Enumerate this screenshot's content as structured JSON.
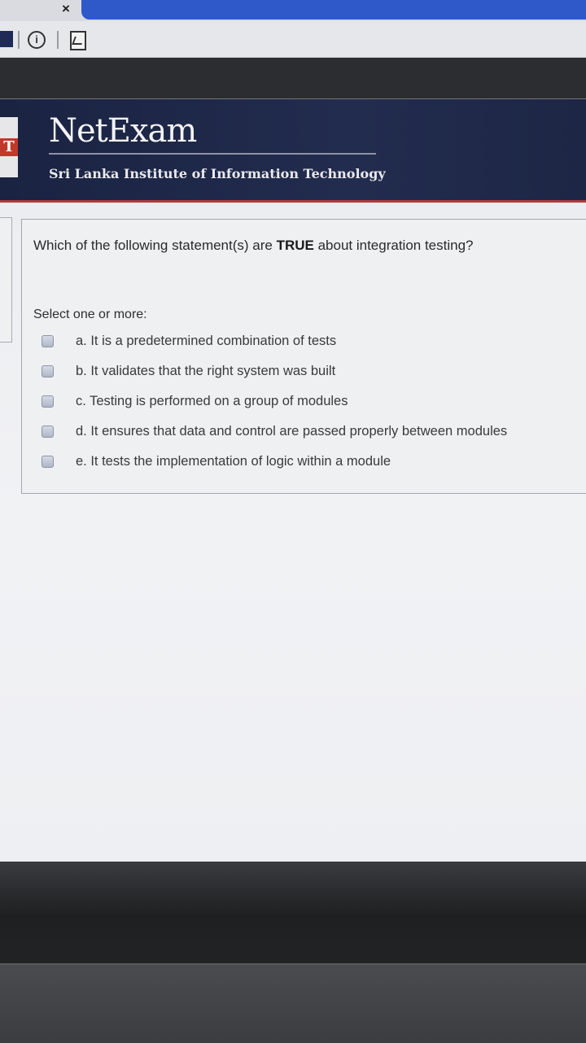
{
  "browser": {
    "tab_close_glyph": "×"
  },
  "header": {
    "title": "NetExam",
    "subtitle": "Sri Lanka Institute of Information Technology"
  },
  "question": {
    "prefix": "Which of the following statement(s) are ",
    "emphasis": "TRUE",
    "suffix": " about integration testing?",
    "prompt": "Select one or more:",
    "options": [
      {
        "label": "a. It is a predetermined combination of tests",
        "checked": false
      },
      {
        "label": "b. It validates that the right system was built",
        "checked": false
      },
      {
        "label": "c. Testing is performed on a group of modules",
        "checked": false
      },
      {
        "label": "d. It ensures that data and control are passed properly between modules",
        "checked": false
      },
      {
        "label": "e. It tests the implementation of logic within a module",
        "checked": false
      }
    ]
  }
}
